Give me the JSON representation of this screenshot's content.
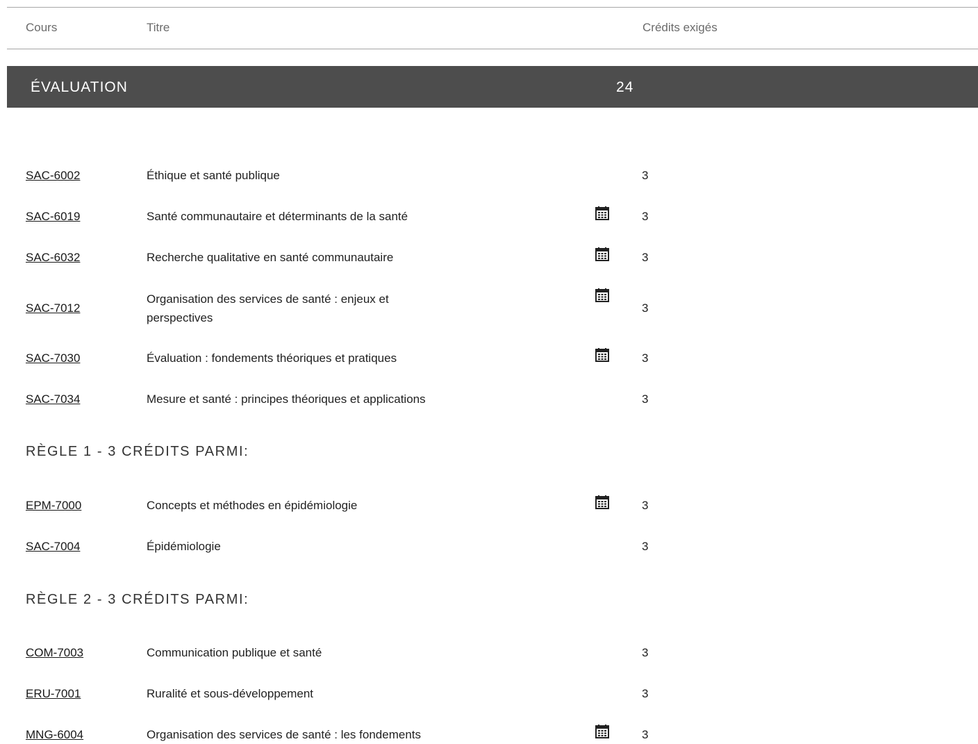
{
  "header": {
    "course": "Cours",
    "title": "Titre",
    "credits": "Crédits exigés"
  },
  "section": {
    "title": "ÉVALUATION",
    "credits": "24"
  },
  "courses": [
    {
      "code": "SAC-6002",
      "title": "Éthique et santé publique",
      "credits": "3",
      "schedule_icon": false
    },
    {
      "code": "SAC-6019",
      "title": "Santé communautaire et déterminants de la santé",
      "credits": "3",
      "schedule_icon": true
    },
    {
      "code": "SAC-6032",
      "title": "Recherche qualitative en santé communautaire",
      "credits": "3",
      "schedule_icon": true
    },
    {
      "code": "SAC-7012",
      "title": "Organisation des services de santé : enjeux et perspectives",
      "credits": "3",
      "schedule_icon": true
    },
    {
      "code": "SAC-7030",
      "title": "Évaluation : fondements théoriques et pratiques",
      "credits": "3",
      "schedule_icon": true
    },
    {
      "code": "SAC-7034",
      "title": "Mesure et santé : principes théoriques et applications",
      "credits": "3",
      "schedule_icon": false
    }
  ],
  "rules": [
    {
      "title": "RÈGLE 1 - 3 CRÉDITS PARMI:",
      "courses": [
        {
          "code": "EPM-7000",
          "title": "Concepts et méthodes en épidémiologie",
          "credits": "3",
          "schedule_icon": true
        },
        {
          "code": "SAC-7004",
          "title": "Épidémiologie",
          "credits": "3",
          "schedule_icon": false
        }
      ]
    },
    {
      "title": "RÈGLE 2 - 3 CRÉDITS PARMI:",
      "courses": [
        {
          "code": "COM-7003",
          "title": "Communication publique et santé",
          "credits": "3",
          "schedule_icon": false
        },
        {
          "code": "ERU-7001",
          "title": "Ruralité et sous-développement",
          "credits": "3",
          "schedule_icon": false
        },
        {
          "code": "MNG-6004",
          "title": "Organisation des services de santé : les fondements",
          "credits": "3",
          "schedule_icon": true
        }
      ]
    }
  ],
  "icons": {
    "schedule": "calendar-icon"
  }
}
